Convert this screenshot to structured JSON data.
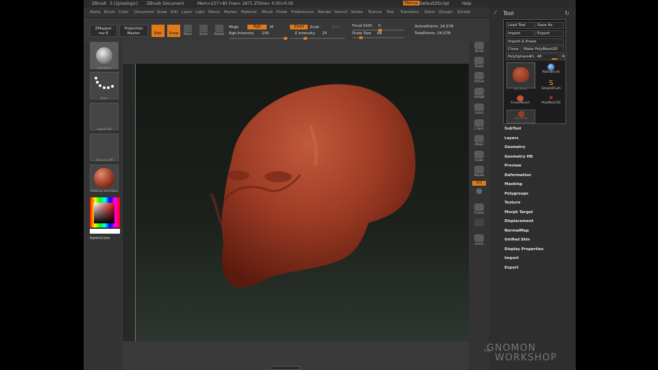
{
  "titlebar": {
    "app": "ZBrush",
    "version": "3.1[pixologic]",
    "doc": "ZBrush Document",
    "mem": "Mem>237+85 Free> 2871 ZTime> 0.00>0.05",
    "menus_label": "Menus",
    "zscript_label": "DefaultZScript",
    "help_label": "Help"
  },
  "menubar": [
    "Alpha",
    "Brush",
    "Color",
    "Document",
    "Draw",
    "Edit",
    "Layer",
    "Light",
    "Macro",
    "Marker",
    "Material",
    "Movie",
    "Picker",
    "Preferences",
    "Render",
    "Stencil",
    "Stroke",
    "Texture",
    "Tool",
    "Transform",
    "Zoom",
    "Zplugin",
    "Zscript"
  ],
  "toolbar": {
    "zmapper": "ZMapper",
    "zmapper_sub": "rev-E",
    "projection": "Projection",
    "projection_sub": "Master",
    "edit": "Edit",
    "draw": "Draw",
    "move": "Move",
    "scale": "Scale",
    "rotate": "Rotate",
    "mrgb": "Mrgb",
    "rgb": "Rgb",
    "m": "M",
    "rgb_intensity_label": "Rgb Intensity",
    "rgb_intensity": "100",
    "zadd": "Zadd",
    "zsub": "Zsub",
    "zcut": "Zcut",
    "z_intensity_label": "Z Intensity",
    "z_intensity": "25",
    "focal_shift_label": "Focal Shift",
    "focal_shift": "0",
    "draw_size_label": "Draw Size",
    "draw_size": "48",
    "active_points": "ActivePoints: 24,578",
    "total_points": "TotalPoints: 24,578"
  },
  "leftshelf": {
    "brush_label": "Standard",
    "stroke_label": "Dots",
    "alpha_label": "Alpha Off",
    "texture_label": "Texture Off",
    "material_label": "MatCap Red Wax",
    "switch_color": "SwitchColor"
  },
  "rightshelf": [
    "Scroll",
    "Zoom",
    "Actual",
    "AAHalf",
    "Local",
    "L.Sym",
    "Move",
    "Scale",
    "Rotate",
    "Frame",
    "Lasso"
  ],
  "rightshelf_xyz": "XYZ",
  "tray": {
    "title": "Tool",
    "load_tool": "Load Tool",
    "save_as": "Save As",
    "import": "Import",
    "export": "Export",
    "import_erase": "Import & Erase",
    "clone": "Clone",
    "make_polymesh": "Make PolyMesh3D",
    "current_tool": "PolySphere#1. 48",
    "r": "R",
    "tools": [
      "old_Smo",
      "AlphaBrush",
      "SimpleBrush",
      "EraserBrush",
      "PolyMesh3D",
      "old_Smo"
    ],
    "subpalettes": [
      "SubTool",
      "Layers",
      "Geometry",
      "Geometry HD",
      "Preview",
      "Deformation",
      "Masking",
      "Polygroups",
      "Texture",
      "Morph Target",
      "Displacement",
      "NormalMap",
      "Unified Skin",
      "Display Properties",
      "Import",
      "Export"
    ]
  },
  "watermark": {
    "the": "THE",
    "line1": "GNOMON",
    "line2": "WORKSHOP"
  },
  "colors": {
    "accent": "#e07a1a",
    "model": "#9c3b24",
    "panel": "#3a3a3a",
    "tray": "#2e2e2e"
  }
}
